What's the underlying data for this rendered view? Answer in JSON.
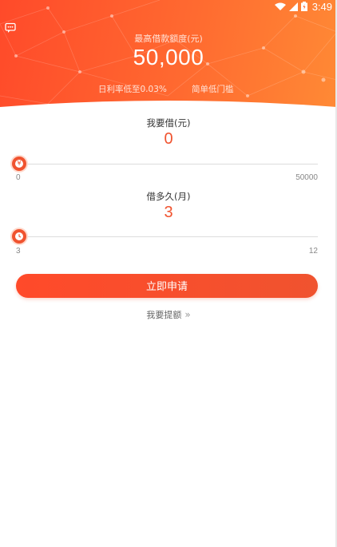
{
  "status_bar": {
    "time": "3:49"
  },
  "header": {
    "limit_label": "最高借款额度(元)",
    "limit_value": "50,000",
    "rate_note": "日利率低至0.03%",
    "threshold_note": "简单低门槛",
    "gradient_colors": [
      "#ff4a2a",
      "#ff8a35"
    ]
  },
  "amount": {
    "title": "我要借(元)",
    "value": "0",
    "min_label": "0",
    "max_label": "50000",
    "level_fraction": 0
  },
  "term": {
    "title": "借多久(月)",
    "value": "3",
    "min_label": "3",
    "max_label": "12",
    "level_fraction": 0
  },
  "apply_button": {
    "label": "立即申请"
  },
  "withdraw_link": {
    "label": "我要提额",
    "chevron": "»"
  },
  "colors": {
    "accent": "#f0532f"
  },
  "icons": [
    "message-icon",
    "wifi-icon",
    "signal-icon",
    "battery-icon",
    "yen-icon",
    "clock-icon",
    "double-chevron-right-icon"
  ]
}
